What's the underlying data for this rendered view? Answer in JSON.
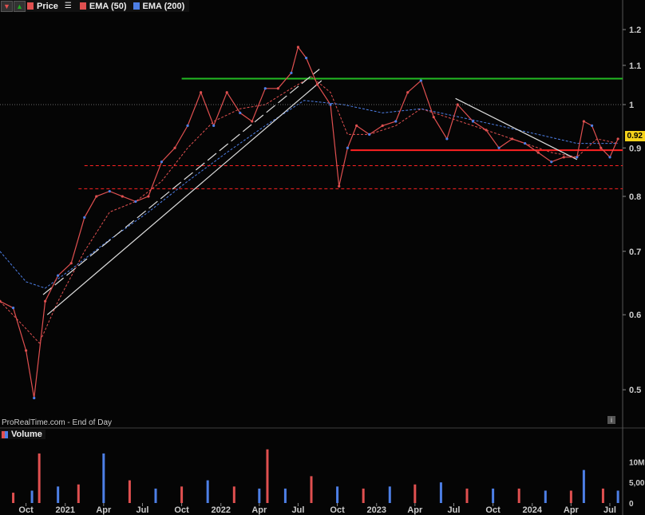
{
  "legend": {
    "price_label": "Price",
    "ema50_label": "EMA (50)",
    "ema200_label": "EMA (200)",
    "price_color": "#e05050",
    "ema50_color": "#e05050",
    "ema200_color": "#4d7fe6"
  },
  "credit": "ProRealTime.com - End of Day",
  "volume_label": "Volume",
  "last_price_tag": "0.92",
  "chart_data": [
    {
      "type": "line",
      "scale": "log",
      "ylim": [
        0.47,
        1.25
      ],
      "yticks": [
        0.5,
        0.6,
        0.7,
        0.8,
        0.9,
        1.0,
        1.1,
        1.2
      ],
      "ytick_labels": [
        "0.5",
        "0.6",
        "0.7",
        "0.8",
        "0.9",
        "1",
        "1.1",
        "1.2"
      ],
      "xlim": [
        "2020-08-01",
        "2024-07-31"
      ],
      "xtick_labels": [
        "Oct",
        "2021",
        "Apr",
        "Jul",
        "Oct",
        "2022",
        "Apr",
        "Jul",
        "Oct",
        "2023",
        "Apr",
        "Jul",
        "Oct",
        "2024",
        "Apr",
        "Jul"
      ],
      "xtick_dates": [
        "2020-10-01",
        "2021-01-01",
        "2021-04-01",
        "2021-07-01",
        "2021-10-01",
        "2022-01-01",
        "2022-04-01",
        "2022-07-01",
        "2022-10-01",
        "2023-01-01",
        "2023-04-01",
        "2023-07-01",
        "2023-10-01",
        "2024-01-01",
        "2024-04-01",
        "2024-07-01"
      ],
      "series": [
        {
          "name": "Price",
          "x": [
            "2020-08-01",
            "2020-09-01",
            "2020-10-01",
            "2020-10-20",
            "2020-11-15",
            "2020-12-15",
            "2021-01-15",
            "2021-02-15",
            "2021-03-15",
            "2021-04-15",
            "2021-05-15",
            "2021-06-15",
            "2021-07-15",
            "2021-08-15",
            "2021-09-15",
            "2021-10-15",
            "2021-11-15",
            "2021-12-15",
            "2022-01-15",
            "2022-02-15",
            "2022-03-15",
            "2022-04-15",
            "2022-05-15",
            "2022-06-15",
            "2022-07-01",
            "2022-07-20",
            "2022-08-15",
            "2022-09-15",
            "2022-10-05",
            "2022-10-25",
            "2022-11-15",
            "2022-12-15",
            "2023-01-15",
            "2023-02-15",
            "2023-03-15",
            "2023-04-15",
            "2023-05-15",
            "2023-06-15",
            "2023-07-10",
            "2023-08-15",
            "2023-09-15",
            "2023-10-15",
            "2023-11-15",
            "2023-12-15",
            "2024-01-15",
            "2024-02-15",
            "2024-03-15",
            "2024-04-15",
            "2024-05-01",
            "2024-05-20",
            "2024-06-10",
            "2024-07-01",
            "2024-07-20"
          ],
          "y": [
            0.62,
            0.61,
            0.55,
            0.49,
            0.62,
            0.66,
            0.68,
            0.76,
            0.8,
            0.81,
            0.8,
            0.79,
            0.8,
            0.87,
            0.9,
            0.95,
            1.03,
            0.95,
            1.03,
            0.98,
            0.96,
            1.04,
            1.04,
            1.08,
            1.15,
            1.12,
            1.05,
            1.0,
            0.82,
            0.9,
            0.95,
            0.93,
            0.95,
            0.96,
            1.03,
            1.06,
            0.97,
            0.92,
            1.0,
            0.96,
            0.94,
            0.9,
            0.92,
            0.91,
            0.89,
            0.87,
            0.88,
            0.88,
            0.96,
            0.95,
            0.9,
            0.88,
            0.92
          ]
        },
        {
          "name": "EMA (50)",
          "x": [
            "2020-08-01",
            "2020-10-01",
            "2020-11-01",
            "2020-12-15",
            "2021-02-15",
            "2021-04-15",
            "2021-06-15",
            "2021-08-15",
            "2021-10-15",
            "2021-12-15",
            "2022-02-15",
            "2022-04-15",
            "2022-06-15",
            "2022-08-01",
            "2022-09-15",
            "2022-10-25",
            "2022-12-15",
            "2023-02-15",
            "2023-04-15",
            "2023-06-15",
            "2023-08-15",
            "2023-10-15",
            "2023-12-15",
            "2024-02-15",
            "2024-04-15",
            "2024-06-01",
            "2024-07-20"
          ],
          "y": [
            0.62,
            0.58,
            0.56,
            0.62,
            0.7,
            0.77,
            0.79,
            0.83,
            0.9,
            0.96,
            0.99,
            1.0,
            1.04,
            1.07,
            1.03,
            0.93,
            0.93,
            0.95,
            0.99,
            0.97,
            0.95,
            0.93,
            0.91,
            0.89,
            0.88,
            0.92,
            0.91
          ]
        },
        {
          "name": "EMA (200)",
          "x": [
            "2020-08-01",
            "2020-10-01",
            "2020-11-15",
            "2021-01-15",
            "2021-04-15",
            "2021-07-15",
            "2021-10-15",
            "2022-01-15",
            "2022-04-15",
            "2022-07-15",
            "2022-10-15",
            "2023-01-15",
            "2023-04-15",
            "2023-07-15",
            "2023-10-15",
            "2024-01-15",
            "2024-04-15",
            "2024-07-20"
          ],
          "y": [
            0.7,
            0.65,
            0.64,
            0.67,
            0.72,
            0.77,
            0.83,
            0.89,
            0.95,
            1.01,
            1.0,
            0.98,
            0.99,
            0.97,
            0.95,
            0.93,
            0.91,
            0.91
          ]
        },
        {
          "name": "Resistance",
          "color": "#22bb22",
          "x": [
            "2021-10-01",
            "2024-07-31"
          ],
          "y": [
            1.065,
            1.065
          ]
        },
        {
          "name": "Support",
          "color": "#ff2222",
          "x": [
            "2022-11-01",
            "2024-07-31"
          ],
          "y": [
            0.895,
            0.895
          ]
        },
        {
          "name": "Support dashed 1",
          "color": "#ff2222",
          "x": [
            "2021-02-15",
            "2024-07-31"
          ],
          "y": [
            0.862,
            0.862
          ]
        },
        {
          "name": "Support dashed 2",
          "color": "#ff2222",
          "x": [
            "2021-02-01",
            "2024-07-31"
          ],
          "y": [
            0.815,
            0.815
          ]
        },
        {
          "name": "Reference 1.0",
          "color": "#888888",
          "x": [
            "2020-08-01",
            "2024-07-31"
          ],
          "y": [
            1.0,
            1.0
          ]
        },
        {
          "name": "Trendline up",
          "color": "#dddddd",
          "x": [
            "2020-11-20",
            "2022-08-25"
          ],
          "y": [
            0.6,
            1.06
          ]
        },
        {
          "name": "Trendline up dashed",
          "color": "#dddddd",
          "x": [
            "2020-11-10",
            "2022-08-20"
          ],
          "y": [
            0.63,
            1.09
          ]
        },
        {
          "name": "Trendline down",
          "color": "#dddddd",
          "x": [
            "2023-07-05",
            "2024-04-15"
          ],
          "y": [
            1.015,
            0.875
          ]
        }
      ]
    },
    {
      "type": "bar",
      "title": "Volume",
      "ytick_labels": [
        "10M",
        "5,00",
        "0"
      ],
      "yticks": [
        10000000,
        5000000,
        0
      ],
      "ylim": [
        0,
        14500000
      ],
      "series": [
        {
          "name": "Volume",
          "x": [
            "2020-09-01",
            "2020-10-15",
            "2020-11-01",
            "2020-12-15",
            "2021-02-01",
            "2021-04-01",
            "2021-06-01",
            "2021-08-01",
            "2021-10-01",
            "2021-12-01",
            "2022-02-01",
            "2022-04-01",
            "2022-04-20",
            "2022-06-01",
            "2022-08-01",
            "2022-10-01",
            "2022-12-01",
            "2023-02-01",
            "2023-04-01",
            "2023-06-01",
            "2023-08-01",
            "2023-10-01",
            "2023-12-01",
            "2024-02-01",
            "2024-04-01",
            "2024-05-01",
            "2024-06-15",
            "2024-07-20"
          ],
          "y": [
            2500000,
            3000000,
            12000000,
            4000000,
            4500000,
            12000000,
            5500000,
            3500000,
            4000000,
            5500000,
            4000000,
            3500000,
            13000000,
            3500000,
            6500000,
            4000000,
            3500000,
            4000000,
            4500000,
            5000000,
            3500000,
            3500000,
            3500000,
            3000000,
            3000000,
            8000000,
            3500000,
            3000000
          ]
        }
      ]
    }
  ]
}
